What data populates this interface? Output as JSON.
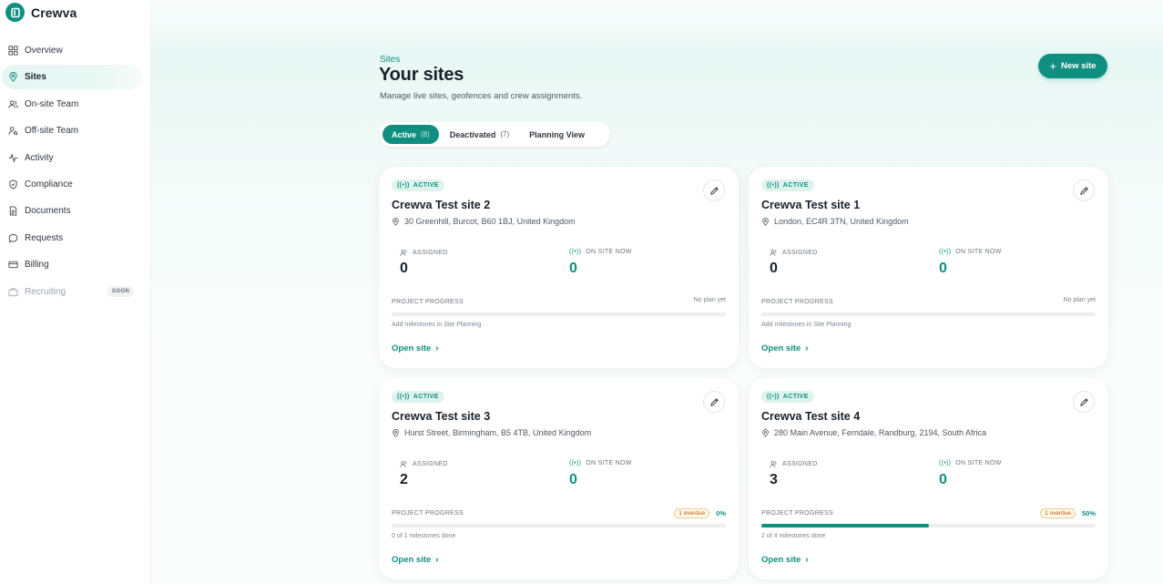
{
  "app": {
    "name": "Crewva"
  },
  "sidebar": {
    "items": [
      {
        "label": "Overview",
        "icon": "grid-icon"
      },
      {
        "label": "Sites",
        "icon": "map-pin-icon",
        "active": true
      },
      {
        "label": "On-site Team",
        "icon": "users-icon"
      },
      {
        "label": "Off-site Team",
        "icon": "user-search-icon"
      },
      {
        "label": "Activity",
        "icon": "activity-icon"
      },
      {
        "label": "Compliance",
        "icon": "shield-icon"
      },
      {
        "label": "Documents",
        "icon": "document-icon"
      },
      {
        "label": "Requests",
        "icon": "chat-icon"
      },
      {
        "label": "Billing",
        "icon": "credit-card-icon"
      },
      {
        "label": "Recruiting",
        "icon": "briefcase-icon",
        "disabled": true,
        "badge": "SOON"
      }
    ]
  },
  "header": {
    "breadcrumb": "Sites",
    "title": "Your sites",
    "subtitle": "Manage live sites, geofences and crew assignments.",
    "new_button": "New site"
  },
  "tabs": [
    {
      "label": "Active",
      "count": "(8)",
      "active": true
    },
    {
      "label": "Deactivated",
      "count": "(7)"
    },
    {
      "label": "Planning View",
      "count": ""
    }
  ],
  "labels": {
    "assigned": "ASSIGNED",
    "on_site_now": "ON SITE NOW",
    "project_progress": "PROJECT PROGRESS",
    "open_site": "Open site"
  },
  "colors": {
    "accent": "#0f8f80",
    "accent_light": "#dff3ee",
    "overdue": "#b45a09"
  },
  "cards": [
    {
      "status": "ACTIVE",
      "title": "Crewva Test site 2",
      "address": "30 Greenhill, Burcot, B60 1BJ, United Kingdom",
      "assigned": "0",
      "on_site_now": "0",
      "progress_right": "No plan yet",
      "overdue": "",
      "percent": "",
      "progress_value": 0,
      "note": "Add milestones in Site Planning"
    },
    {
      "status": "ACTIVE",
      "title": "Crewva Test site 1",
      "address": "London, EC4R 3TN, United Kingdom",
      "assigned": "0",
      "on_site_now": "0",
      "progress_right": "No plan yet",
      "overdue": "",
      "percent": "",
      "progress_value": 0,
      "note": "Add milestones in Site Planning"
    },
    {
      "status": "ACTIVE",
      "title": "Crewva Test site 3",
      "address": "Hurst Street, Birmingham, B5 4TB, United Kingdom",
      "assigned": "2",
      "on_site_now": "0",
      "progress_right": "",
      "overdue": "1 overdue",
      "percent": "0%",
      "progress_value": 0,
      "note": "0 of 1 milestones done"
    },
    {
      "status": "ACTIVE",
      "title": "Crewva Test site 4",
      "address": "280 Main Avenue, Ferndale, Randburg, 2194, South Africa",
      "assigned": "3",
      "on_site_now": "0",
      "progress_right": "",
      "overdue": "1 overdue",
      "percent": "50%",
      "progress_value": 0.5,
      "note": "2 of 4 milestones done"
    }
  ]
}
